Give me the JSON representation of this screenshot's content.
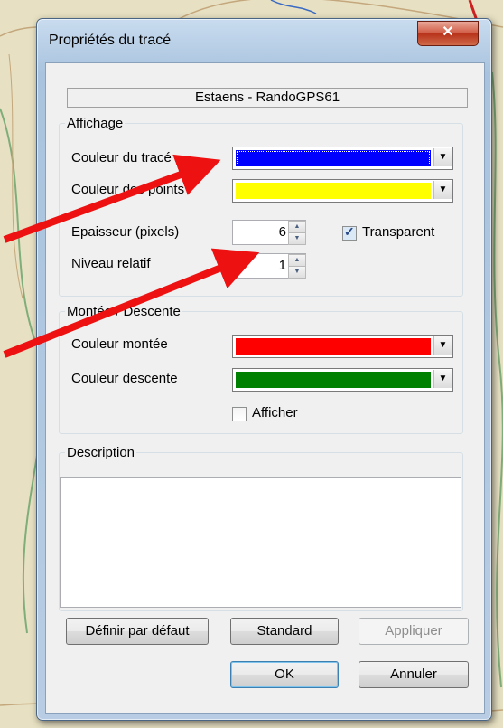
{
  "window": {
    "title": "Propriétés du tracé",
    "close_symbol": "✕",
    "track_name": "Estaens - RandoGPS61"
  },
  "affichage": {
    "legend": "Affichage",
    "couleur_trace": {
      "label": "Couleur du tracé",
      "color": "#0000ff"
    },
    "couleur_points": {
      "label": "Couleur des points",
      "color": "#ffff00"
    },
    "epaisseur": {
      "label": "Epaisseur (pixels)",
      "value": "6"
    },
    "niveau": {
      "label": "Niveau relatif",
      "value": "1"
    },
    "transparent": {
      "label": "Transparent",
      "checked": true
    }
  },
  "montee_descente": {
    "legend": "Montée / Descente",
    "couleur_montee": {
      "label": "Couleur montée",
      "color": "#ff0000"
    },
    "couleur_descente": {
      "label": "Couleur descente",
      "color": "#008000"
    },
    "afficher": {
      "label": "Afficher",
      "checked": false
    }
  },
  "description": {
    "legend": "Description",
    "value": ""
  },
  "buttons": {
    "definir": "Définir par défaut",
    "standard": "Standard",
    "appliquer": "Appliquer",
    "ok": "OK",
    "annuler": "Annuler"
  },
  "colors": {
    "annotation_arrow": "#ee1111"
  }
}
